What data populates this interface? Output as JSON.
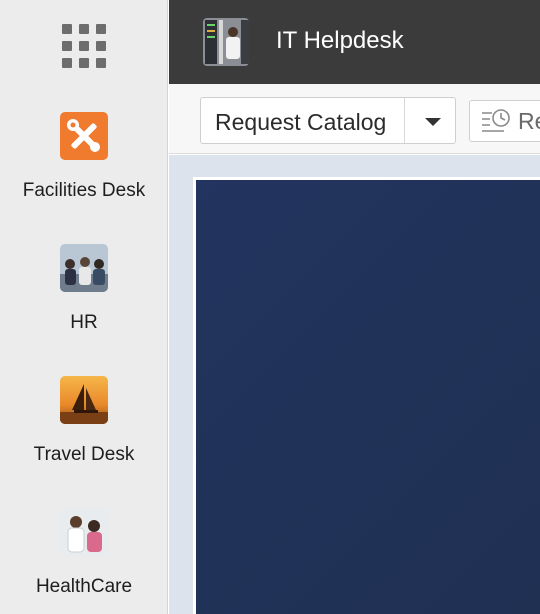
{
  "sidebar": {
    "launcher_icon": "grid-icon",
    "apps": [
      {
        "label": "Facilities Desk",
        "icon": "tools-icon",
        "accent": "#f07a2d"
      },
      {
        "label": "HR",
        "icon": "people-photo-icon"
      },
      {
        "label": "Travel Desk",
        "icon": "sailboat-photo-icon"
      },
      {
        "label": "HealthCare",
        "icon": "doctor-photo-icon"
      }
    ]
  },
  "header": {
    "title": "IT Helpdesk",
    "thumb_icon": "server-room-photo-icon",
    "bg_color": "#3b3b3b"
  },
  "toolbar": {
    "catalog_select": "Request Catalog",
    "history_label": "Re",
    "history_icon": "history-list-icon"
  },
  "colors": {
    "panel": "#22345f",
    "sidebar": "#ececec"
  }
}
